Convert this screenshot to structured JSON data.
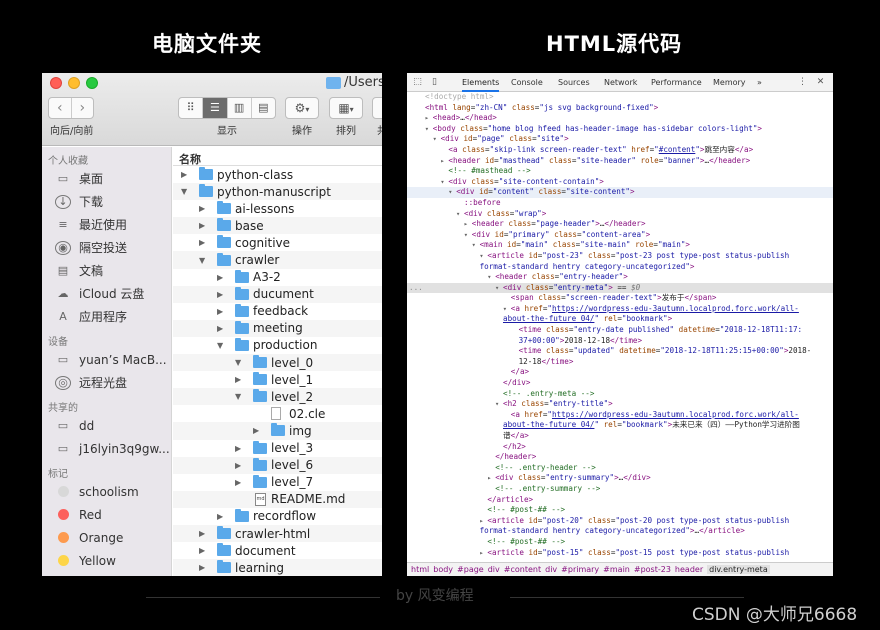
{
  "titles": {
    "left": "电脑文件夹",
    "right": "HTML源代码"
  },
  "finder": {
    "path": "/Users/y",
    "toolbar": {
      "nav_label": "向后/向前",
      "view_label": "显示",
      "action_label": "操作",
      "arrange_label": "排列",
      "extra_label": "共"
    },
    "sidebar": {
      "favorites_header": "个人收藏",
      "favorites": [
        {
          "label": "桌面",
          "icon": "desktop-icon"
        },
        {
          "label": "下载",
          "icon": "download-icon"
        },
        {
          "label": "最近使用",
          "icon": "recents-icon"
        },
        {
          "label": "隔空投送",
          "icon": "airdrop-icon"
        },
        {
          "label": "文稿",
          "icon": "documents-icon"
        },
        {
          "label": "iCloud 云盘",
          "icon": "icloud-icon"
        },
        {
          "label": "应用程序",
          "icon": "applications-icon"
        }
      ],
      "devices_header": "设备",
      "devices": [
        {
          "label": "yuan’s MacB...",
          "icon": "laptop-icon"
        },
        {
          "label": "远程光盘",
          "icon": "disc-icon"
        }
      ],
      "shared_header": "共享的",
      "shared": [
        {
          "label": "dd",
          "icon": "monitor-icon"
        },
        {
          "label": "j16lyin3q9gw...",
          "icon": "monitor-icon"
        }
      ],
      "tags_header": "标记",
      "tags": [
        {
          "label": "schoolism",
          "color": "#d8d8d8"
        },
        {
          "label": "Red",
          "color": "#fc605c"
        },
        {
          "label": "Orange",
          "color": "#fd9a4e"
        },
        {
          "label": "Yellow",
          "color": "#fdd549"
        }
      ]
    },
    "column_header": "名称",
    "files": [
      {
        "name": "python-class",
        "depth": 0,
        "open": false,
        "type": "folder"
      },
      {
        "name": "python-manuscript",
        "depth": 0,
        "open": true,
        "type": "folder"
      },
      {
        "name": "ai-lessons",
        "depth": 1,
        "open": false,
        "type": "folder"
      },
      {
        "name": "base",
        "depth": 1,
        "open": false,
        "type": "folder"
      },
      {
        "name": "cognitive",
        "depth": 1,
        "open": false,
        "type": "folder"
      },
      {
        "name": "crawler",
        "depth": 1,
        "open": true,
        "type": "folder"
      },
      {
        "name": "A3-2",
        "depth": 2,
        "open": false,
        "type": "folder"
      },
      {
        "name": "ducument",
        "depth": 2,
        "open": false,
        "type": "folder"
      },
      {
        "name": "feedback",
        "depth": 2,
        "open": false,
        "type": "folder"
      },
      {
        "name": "meeting",
        "depth": 2,
        "open": false,
        "type": "folder"
      },
      {
        "name": "production",
        "depth": 2,
        "open": true,
        "type": "folder"
      },
      {
        "name": "level_0",
        "depth": 3,
        "open": true,
        "type": "folder"
      },
      {
        "name": "level_1",
        "depth": 3,
        "open": false,
        "type": "folder"
      },
      {
        "name": "level_2",
        "depth": 3,
        "open": true,
        "type": "folder"
      },
      {
        "name": "02.cle",
        "depth": 4,
        "open": false,
        "type": "file"
      },
      {
        "name": "img",
        "depth": 4,
        "open": false,
        "type": "folder"
      },
      {
        "name": "level_3",
        "depth": 3,
        "open": false,
        "type": "folder"
      },
      {
        "name": "level_6",
        "depth": 3,
        "open": false,
        "type": "folder"
      },
      {
        "name": "level_7",
        "depth": 3,
        "open": false,
        "type": "folder"
      },
      {
        "name": "README.md",
        "depth": 3,
        "open": false,
        "type": "md"
      },
      {
        "name": "recordflow",
        "depth": 2,
        "open": false,
        "type": "folder"
      },
      {
        "name": "crawler-html",
        "depth": 1,
        "open": false,
        "type": "folder"
      },
      {
        "name": "document",
        "depth": 1,
        "open": false,
        "type": "folder"
      },
      {
        "name": "learning",
        "depth": 1,
        "open": false,
        "type": "folder"
      }
    ]
  },
  "devtools": {
    "tabs": [
      "Elements",
      "Console",
      "Sources",
      "Network",
      "Performance",
      "Memory"
    ],
    "active_tab": "Elements",
    "more": "»",
    "breadcrumbs": [
      "html",
      "body",
      "#page",
      "div",
      "#content",
      "div",
      "#primary",
      "#main",
      "#post-23",
      "header",
      "div.entry-meta"
    ],
    "lines": [
      {
        "i": 0,
        "a": "",
        "h": "<span class='gr'>&lt;!doctype html&gt;</span>"
      },
      {
        "i": 0,
        "a": "",
        "h": "<span class='tg'>&lt;html</span> <span class='an'>lang</span>=<span class='av'>\"zh-CN\"</span> <span class='an'>class</span>=<span class='av'>\"js svg background-fixed\"</span><span class='tg'>&gt;</span>"
      },
      {
        "i": 1,
        "a": "▸",
        "h": "<span class='tg'>&lt;head&gt;</span>…<span class='tg'>&lt;/head&gt;</span>"
      },
      {
        "i": 1,
        "a": "▾",
        "h": "<span class='tg'>&lt;body</span> <span class='an'>class</span>=<span class='av'>\"home blog hfeed has-header-image has-sidebar colors-light\"</span><span class='tg'>&gt;</span>"
      },
      {
        "i": 2,
        "a": "▾",
        "h": "<span class='tg'>&lt;div</span> <span class='an'>id</span>=<span class='av'>\"page\"</span> <span class='an'>class</span>=<span class='av'>\"site\"</span><span class='tg'>&gt;</span>"
      },
      {
        "i": 3,
        "a": "",
        "h": "<span class='tg'>&lt;a</span> <span class='an'>class</span>=<span class='av'>\"skip-link screen-reader-text\"</span> <span class='an'>href</span>=<span class='av'>\"<span class='lk'>#content</span>\"</span><span class='tg'>&gt;</span><span class='tx'>跳至内容</span><span class='tg'>&lt;/a&gt;</span>"
      },
      {
        "i": 3,
        "a": "▸",
        "h": "<span class='tg'>&lt;header</span> <span class='an'>id</span>=<span class='av'>\"masthead\"</span> <span class='an'>class</span>=<span class='av'>\"site-header\"</span> <span class='an'>role</span>=<span class='av'>\"banner\"</span><span class='tg'>&gt;</span>…<span class='tg'>&lt;/header&gt;</span>"
      },
      {
        "i": 3,
        "a": "",
        "h": "<span class='cm'>&lt;!-- #masthead --&gt;</span>"
      },
      {
        "i": 3,
        "a": "▾",
        "h": "<span class='tg'>&lt;div</span> <span class='an'>class</span>=<span class='av'>\"site-content-contain\"</span><span class='tg'>&gt;</span>"
      },
      {
        "i": 4,
        "a": "▾",
        "c": "hover",
        "h": "<span class='tg'>&lt;div</span> <span class='an'>id</span>=<span class='av'>\"content\"</span> <span class='an'>class</span>=<span class='av'>\"site-content\"</span><span class='tg'>&gt;</span>"
      },
      {
        "i": 5,
        "a": "",
        "h": "<span class='tg'>::before</span>"
      },
      {
        "i": 5,
        "a": "▾",
        "h": "<span class='tg'>&lt;div</span> <span class='an'>class</span>=<span class='av'>\"wrap\"</span><span class='tg'>&gt;</span>"
      },
      {
        "i": 6,
        "a": "▸",
        "h": "<span class='tg'>&lt;header</span> <span class='an'>class</span>=<span class='av'>\"page-header\"</span><span class='tg'>&gt;</span>…<span class='tg'>&lt;/header&gt;</span>"
      },
      {
        "i": 6,
        "a": "▾",
        "h": "<span class='tg'>&lt;div</span> <span class='an'>id</span>=<span class='av'>\"primary\"</span> <span class='an'>class</span>=<span class='av'>\"content-area\"</span><span class='tg'>&gt;</span>"
      },
      {
        "i": 7,
        "a": "▾",
        "h": "<span class='tg'>&lt;main</span> <span class='an'>id</span>=<span class='av'>\"main\"</span> <span class='an'>class</span>=<span class='av'>\"site-main\"</span> <span class='an'>role</span>=<span class='av'>\"main\"</span><span class='tg'>&gt;</span>"
      },
      {
        "i": 8,
        "a": "▾",
        "h": "<span class='tg'>&lt;article</span> <span class='an'>id</span>=<span class='av'>\"post-23\"</span> <span class='an'>class</span>=<span class='av'>\"post-23 post type-post status-publish</span>"
      },
      {
        "i": 7,
        "a": "",
        "h": "<span class='av'>format-standard hentry category-uncategorized\"</span><span class='tg'>&gt;</span>"
      },
      {
        "i": 9,
        "a": "▾",
        "h": "<span class='tg'>&lt;header</span> <span class='an'>class</span>=<span class='av'>\"entry-header\"</span><span class='tg'>&gt;</span>"
      },
      {
        "i": 10,
        "a": "▾",
        "c": "sel",
        "dots": true,
        "h": "<span class='tg'>&lt;div</span> <span class='an'>class</span>=<span class='av'>\"entry-meta\"</span><span class='tg'>&gt;</span> == <span style='color:#777;font-style:italic'>$0</span>"
      },
      {
        "i": 11,
        "a": "",
        "h": "<span class='tg'>&lt;span</span> <span class='an'>class</span>=<span class='av'>\"screen-reader-text\"</span><span class='tg'>&gt;</span><span class='tx'>发布于</span><span class='tg'>&lt;/span&gt;</span>"
      },
      {
        "i": 11,
        "a": "▾",
        "h": "<span class='tg'>&lt;a</span> <span class='an'>href</span>=<span class='av'>\"<span class='lk'>https://wordpress-edu-3autumn.localprod.forc.work/all-</span></span>"
      },
      {
        "i": 10,
        "a": "",
        "h": "<span class='lk' style='color:#1a1aa6'>about-the-future 04/</span><span class='av'>\"</span> <span class='an'>rel</span>=<span class='av'>\"bookmark\"</span><span class='tg'>&gt;</span>"
      },
      {
        "i": 12,
        "a": "",
        "h": "<span class='tg'>&lt;time</span> <span class='an'>class</span>=<span class='av'>\"entry-date published\"</span> <span class='an'>datetime</span>=<span class='av'>\"2018-12-18T11:17:</span>"
      },
      {
        "i": 12,
        "a": "",
        "h": "<span class='av'>37+00:00\"</span><span class='tg'>&gt;</span><span class='tx'>2018-12-18</span><span class='tg'>&lt;/time&gt;</span>"
      },
      {
        "i": 12,
        "a": "",
        "h": "<span class='tg'>&lt;time</span> <span class='an'>class</span>=<span class='av'>\"updated\"</span> <span class='an'>datetime</span>=<span class='av'>\"2018-12-18T11:25:15+00:00\"</span><span class='tg'>&gt;</span><span class='tx'>2018-</span>"
      },
      {
        "i": 12,
        "a": "",
        "h": "<span class='tx'>12-18</span><span class='tg'>&lt;/time&gt;</span>"
      },
      {
        "i": 11,
        "a": "",
        "h": "<span class='tg'>&lt;/a&gt;</span>"
      },
      {
        "i": 10,
        "a": "",
        "h": "<span class='tg'>&lt;/div&gt;</span>"
      },
      {
        "i": 10,
        "a": "",
        "h": "<span class='cm'>&lt;!-- .entry-meta --&gt;</span>"
      },
      {
        "i": 10,
        "a": "▾",
        "h": "<span class='tg'>&lt;h2</span> <span class='an'>class</span>=<span class='av'>\"entry-title\"</span><span class='tg'>&gt;</span>"
      },
      {
        "i": 11,
        "a": "",
        "h": "<span class='tg'>&lt;a</span> <span class='an'>href</span>=<span class='av'>\"<span class='lk'>https://wordpress-edu-3autumn.localprod.forc.work/all-</span></span>"
      },
      {
        "i": 10,
        "a": "",
        "h": "<span class='lk'>about-the-future 04/</span><span class='av'>\"</span> <span class='an'>rel</span>=<span class='av'>\"bookmark\"</span><span class='tg'>&gt;</span><span class='tx'>未来已来（四）——Python学习进阶图</span>"
      },
      {
        "i": 10,
        "a": "",
        "h": "<span class='tx'>谱</span><span class='tg'>&lt;/a&gt;</span>"
      },
      {
        "i": 10,
        "a": "",
        "h": "<span class='tg'>&lt;/h2&gt;</span>"
      },
      {
        "i": 9,
        "a": "",
        "h": "<span class='tg'>&lt;/header&gt;</span>"
      },
      {
        "i": 9,
        "a": "",
        "h": "<span class='cm'>&lt;!-- .entry-header --&gt;</span>"
      },
      {
        "i": 9,
        "a": "▸",
        "h": "<span class='tg'>&lt;div</span> <span class='an'>class</span>=<span class='av'>\"entry-summary\"</span><span class='tg'>&gt;</span>…<span class='tg'>&lt;/div&gt;</span>"
      },
      {
        "i": 9,
        "a": "",
        "h": "<span class='cm'>&lt;!-- .entry-summary --&gt;</span>"
      },
      {
        "i": 8,
        "a": "",
        "h": "<span class='tg'>&lt;/article&gt;</span>"
      },
      {
        "i": 8,
        "a": "",
        "h": "<span class='cm'>&lt;!-- #post-## --&gt;</span>"
      },
      {
        "i": 8,
        "a": "▸",
        "h": "<span class='tg'>&lt;article</span> <span class='an'>id</span>=<span class='av'>\"post-20\"</span> <span class='an'>class</span>=<span class='av'>\"post-20 post type-post status-publish</span>"
      },
      {
        "i": 7,
        "a": "",
        "h": "<span class='av'>format-standard hentry category-uncategorized\"</span><span class='tg'>&gt;</span>…<span class='tg'>&lt;/article&gt;</span>"
      },
      {
        "i": 8,
        "a": "",
        "h": "<span class='cm'>&lt;!-- #post-## --&gt;</span>"
      },
      {
        "i": 8,
        "a": "▸",
        "h": "<span class='tg'>&lt;article</span> <span class='an'>id</span>=<span class='av'>\"post-15\"</span> <span class='an'>class</span>=<span class='av'>\"post-15 post type-post status-publish</span>"
      }
    ]
  },
  "byline": "by 风变编程",
  "watermark": "CSDN @大师兄6668"
}
